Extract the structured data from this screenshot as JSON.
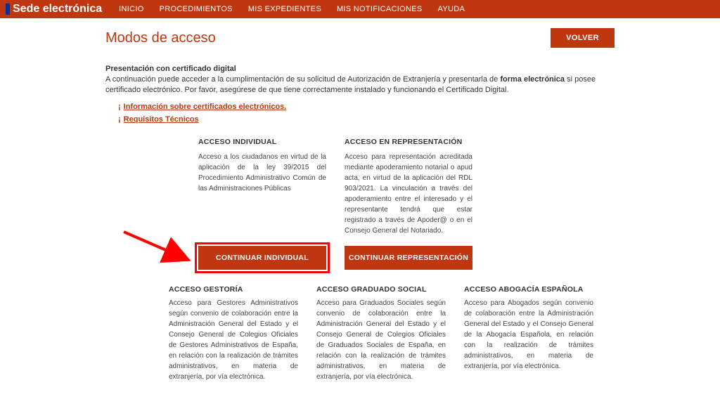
{
  "header": {
    "brand": "Sede electrónica",
    "nav": [
      "INICIO",
      "PROCEDIMIENTOS",
      "MIS EXPEDIENTES",
      "MIS NOTIFICACIONES",
      "AYUDA"
    ]
  },
  "page_title": "Modos de acceso",
  "volver_label": "VOLVER",
  "intro": {
    "heading": "Presentación con certificado digital",
    "body_pre": "A continuación puede acceder a la cumplimentación de su solicitud de Autorización de Extranjería y presentarla de ",
    "body_em": "forma electrónica",
    "body_post": " si posee certificado electrónico. Por favor, asegúrese de que tiene correctamente instalado y funcionando el Certificado Digital."
  },
  "links": [
    "Información sobre certificados electrónicos.",
    "Requisitos Técnicos"
  ],
  "top_cols": [
    {
      "title": "ACCESO INDIVIDUAL",
      "text": "Acceso a los ciudadanos en virtud de la aplicación de la ley 39/2015 del Procedimiento Administrativo Común de las Administraciones Públicas"
    },
    {
      "title": "ACCESO EN REPRESENTACIÓN",
      "text": "Acceso para representación acreditada mediante apoderamiento notarial o apud acta, en virtud de la aplicación del RDL 903/2021. La vinculación a través del apoderamiento entre el interesado y el representante tendrá que estar registrado a través de Apoder@ o en el Consejo General del Notariado."
    }
  ],
  "buttons": {
    "individual": "CONTINUAR INDIVIDUAL",
    "representacion": "CONTINUAR REPRESENTACIÓN"
  },
  "bottom_cols": [
    {
      "title": "ACCESO GESTORÍA",
      "text": "Acceso para Gestores Administrativos según convenio de colaboración entre la Administración General del Estado y el Consejo General de Colegios Oficiales de Gestores Administrativos de España, en relación con la realización de trámites administrativos, en materia de extranjería, por vía electrónica."
    },
    {
      "title": "ACCESO GRADUADO SOCIAL",
      "text": "Acceso para Graduados Sociales según convenio de colaboración entre la Administración General del Estado y el Consejo General de Colegios Oficiales de Graduados Sociales de España, en relación con la realización de trámites administrativos, en materia de extranjería, por vía electrónica."
    },
    {
      "title": "ACCESO ABOGACÍA ESPAÑOLA",
      "text": "Acceso para Abogados según convenio de colaboración entre la Administración General del Estado y el Consejo General de la Abogacía Española, en relación con la realización de trámites administrativos, en materia de extranjería, por vía electrónica."
    }
  ]
}
